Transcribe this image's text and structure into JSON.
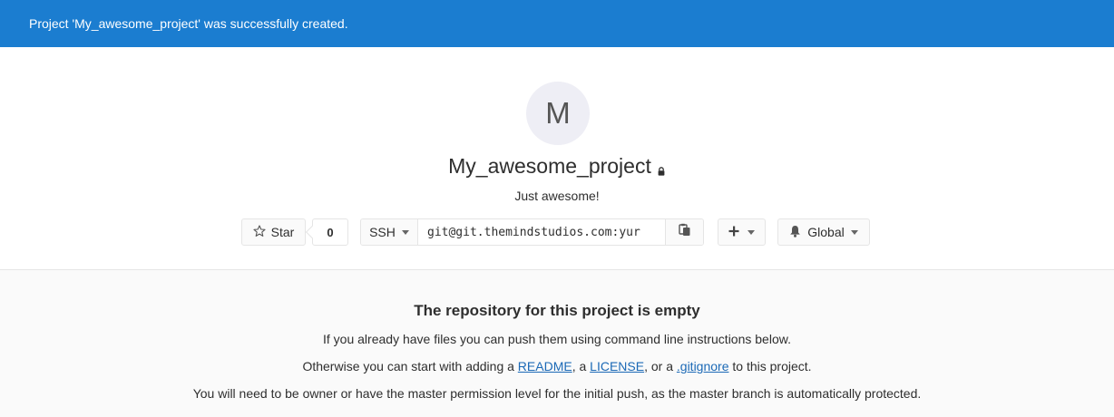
{
  "flash": {
    "message": "Project 'My_awesome_project' was successfully created."
  },
  "project": {
    "avatar_letter": "M",
    "name": "My_awesome_project",
    "visibility_icon": "lock-icon",
    "description": "Just awesome!"
  },
  "controls": {
    "star_label": "Star",
    "star_count": "0",
    "protocol": "SSH",
    "clone_url": "git@git.themindstudios.com:yur",
    "notification_level": "Global"
  },
  "empty": {
    "title": "The repository for this project is empty",
    "line1": "If you already have files you can push them using command line instructions below.",
    "line2_prefix": "Otherwise you can start with adding a ",
    "readme": "README",
    "sep1": ", a ",
    "license": "LICENSE",
    "sep2": ", or a ",
    "gitignore": ".gitignore",
    "line2_suffix": " to this project.",
    "line3": "You will need to be owner or have the master permission level for the initial push, as the master branch is automatically protected."
  },
  "colors": {
    "flash_bg": "#1b7dd0",
    "link": "#1b69b6"
  }
}
